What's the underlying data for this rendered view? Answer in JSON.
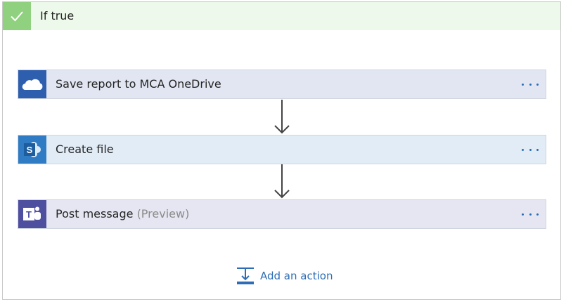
{
  "condition": {
    "title": "If true",
    "accent_color": "#8fd17f",
    "header_bg": "#edf9ea"
  },
  "actions": [
    {
      "label": "Save report to MCA OneDrive",
      "suffix": "",
      "icon": "onedrive-icon",
      "icon_bg": "#2e5fae",
      "card_bg": "#e1e6f2",
      "menu_label": "more-options"
    },
    {
      "label": "Create file",
      "suffix": "",
      "icon": "sharepoint-icon",
      "icon_bg": "#2f7bc4",
      "card_bg": "#e2ecf6",
      "menu_label": "more-options"
    },
    {
      "label": "Post message",
      "suffix": "(Preview)",
      "icon": "teams-icon",
      "icon_bg": "#4f4fa0",
      "card_bg": "#e6e6f2",
      "menu_label": "more-options"
    }
  ],
  "add_action": {
    "label": "Add an action",
    "icon": "add-action-icon",
    "color": "#2d6db5"
  }
}
